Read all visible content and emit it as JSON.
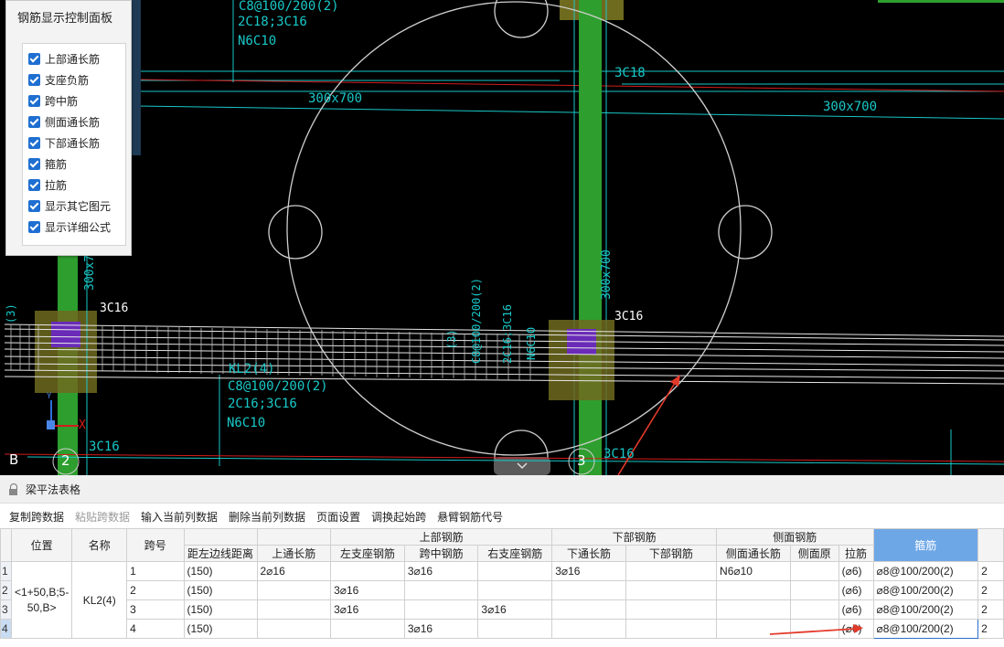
{
  "control_panel": {
    "title": "钢筋显示控制面板",
    "options": [
      {
        "label": "上部通长筋",
        "checked": true
      },
      {
        "label": "支座负筋",
        "checked": true
      },
      {
        "label": "跨中筋",
        "checked": true
      },
      {
        "label": "侧面通长筋",
        "checked": true
      },
      {
        "label": "下部通长筋",
        "checked": true
      },
      {
        "label": "箍筋",
        "checked": true
      },
      {
        "label": "拉筋",
        "checked": true
      },
      {
        "label": "显示其它图元",
        "checked": true
      },
      {
        "label": "显示详细公式",
        "checked": true
      }
    ]
  },
  "cad": {
    "labels": {
      "top_stirrup": "C8@100/200(2)",
      "top_bars": "2C18;3C16",
      "top_side": "N6C10",
      "c3c18": "3C18",
      "beam_300x700_a": "300x700",
      "beam_300x700_b": "300x700",
      "col_300x700_left": "300x70",
      "col_300x700_right": "300x700",
      "c3c16_left": "3C16",
      "c3c16_right": "3C16",
      "kl2": "KL2(4)",
      "mid_stirrup": "C8@100/200(2)",
      "mid_bars": "2C16;3C16",
      "mid_side": "N6C10",
      "bottom_3c16_left": "3C16",
      "bottom_3c16_right": "3C16",
      "axis_b": "B",
      "axis_2": "2",
      "axis_3": "3",
      "axis_x": "X",
      "axis_y": "Y",
      "rot_text_a": "(3)",
      "rot_text_b": "C8@100/200(2)",
      "rot_text_c": "2C16;3C16",
      "rot_text_d": "N6C10",
      "rot_text_e": "(3)"
    },
    "colors": {
      "cyan": "#19c8c8",
      "green": "#2e9e2e",
      "red": "#d21d1d",
      "purple": "#6a2bb8",
      "olive": "#6e6a1e"
    }
  },
  "bottom_panel": {
    "title": "梁平法表格",
    "toolbar": [
      {
        "label": "复制跨数据",
        "enabled": true
      },
      {
        "label": "粘贴跨数据",
        "enabled": false
      },
      {
        "label": "输入当前列数据",
        "enabled": true
      },
      {
        "label": "删除当前列数据",
        "enabled": true
      },
      {
        "label": "页面设置",
        "enabled": true
      },
      {
        "label": "调换起始跨",
        "enabled": true
      },
      {
        "label": "悬臂钢筋代号",
        "enabled": true
      }
    ],
    "table": {
      "headers": {
        "position": "位置",
        "name": "名称",
        "span": "跨号",
        "dist_left": "距左边线距离",
        "top_long": "上通长筋",
        "top_group": "上部钢筋",
        "left_support": "左支座钢筋",
        "mid_span": "跨中钢筋",
        "right_support": "右支座钢筋",
        "bottom_group": "下部钢筋",
        "bottom_long": "下通长筋",
        "bottom_steel": "下部钢筋",
        "side_group": "侧面钢筋",
        "side_long": "侧面通长筋",
        "side_orig": "侧面原",
        "tie": "拉筋",
        "stirrup": "箍筋"
      },
      "position_value": "<1+50,B;5-50,B>",
      "name_value": "KL2(4)",
      "rows": [
        {
          "rownum": "1",
          "span": "1",
          "dist_left": "(150)",
          "top_long": "2⌀16",
          "left_support": "",
          "mid_span": "3⌀16",
          "right_support": "",
          "bottom_long": "3⌀16",
          "bottom_steel": "",
          "side_long": "N6⌀10",
          "side_orig": "",
          "tie": "(⌀6)",
          "stirrup": "⌀8@100/200(2)",
          "extra": "2"
        },
        {
          "rownum": "2",
          "span": "2",
          "dist_left": "(150)",
          "top_long": "",
          "left_support": "3⌀16",
          "mid_span": "",
          "right_support": "",
          "bottom_long": "",
          "bottom_steel": "",
          "side_long": "",
          "side_orig": "",
          "tie": "(⌀6)",
          "stirrup": "⌀8@100/200(2)",
          "extra": "2"
        },
        {
          "rownum": "3",
          "span": "3",
          "dist_left": "(150)",
          "top_long": "",
          "left_support": "3⌀16",
          "mid_span": "",
          "right_support": "3⌀16",
          "bottom_long": "",
          "bottom_steel": "",
          "side_long": "",
          "side_orig": "",
          "tie": "(⌀6)",
          "stirrup": "⌀8@100/200(2)",
          "extra": "2"
        },
        {
          "rownum": "4",
          "span": "4",
          "dist_left": "(150)",
          "top_long": "",
          "left_support": "",
          "mid_span": "3⌀16",
          "right_support": "",
          "bottom_long": "",
          "bottom_steel": "",
          "side_long": "",
          "side_orig": "",
          "tie": "(⌀6)",
          "stirrup": "⌀8@100/200(2)",
          "extra": "2"
        }
      ]
    }
  }
}
